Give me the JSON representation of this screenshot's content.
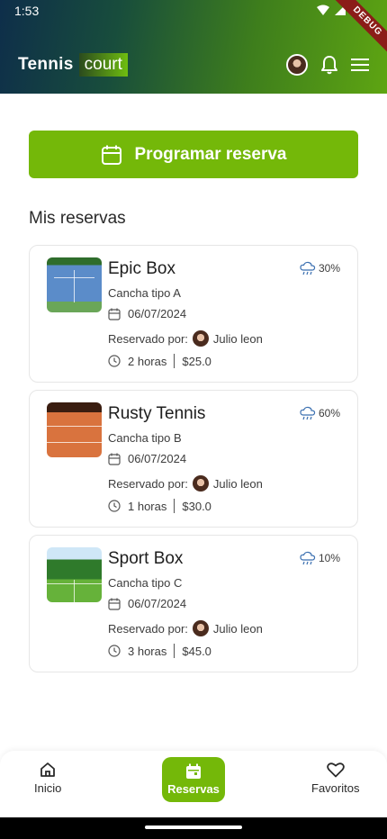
{
  "status_bar": {
    "time": "1:53"
  },
  "debug_banner": "DEBUG",
  "brand": {
    "part1": "Tennis",
    "part2": "court"
  },
  "primary_action": {
    "label": "Programar reserva"
  },
  "section_title": "Mis reservas",
  "reservations": [
    {
      "name": "Epic Box",
      "court_type": "Cancha tipo A",
      "date": "06/07/2024",
      "booked_by_label": "Reservado por:",
      "booked_by": "Julio leon",
      "duration": "2 horas",
      "price": "$25.0",
      "rain_chance": "30%"
    },
    {
      "name": "Rusty Tennis",
      "court_type": "Cancha tipo B",
      "date": "06/07/2024",
      "booked_by_label": "Reservado por:",
      "booked_by": "Julio leon",
      "duration": "1 horas",
      "price": "$30.0",
      "rain_chance": "60%"
    },
    {
      "name": "Sport Box",
      "court_type": "Cancha tipo C",
      "date": "06/07/2024",
      "booked_by_label": "Reservado por:",
      "booked_by": "Julio leon",
      "duration": "3 horas",
      "price": "$45.0",
      "rain_chance": "10%"
    }
  ],
  "bottom_nav": {
    "items": [
      {
        "label": "Inicio",
        "icon": "home-icon",
        "active": false
      },
      {
        "label": "Reservas",
        "icon": "calendar-icon",
        "active": true
      },
      {
        "label": "Favoritos",
        "icon": "heart-icon",
        "active": false
      }
    ]
  },
  "colors": {
    "accent": "#74b809",
    "header_dark": "#0e2e4a",
    "header_light": "#5ea512",
    "debug": "#8b1d18"
  }
}
